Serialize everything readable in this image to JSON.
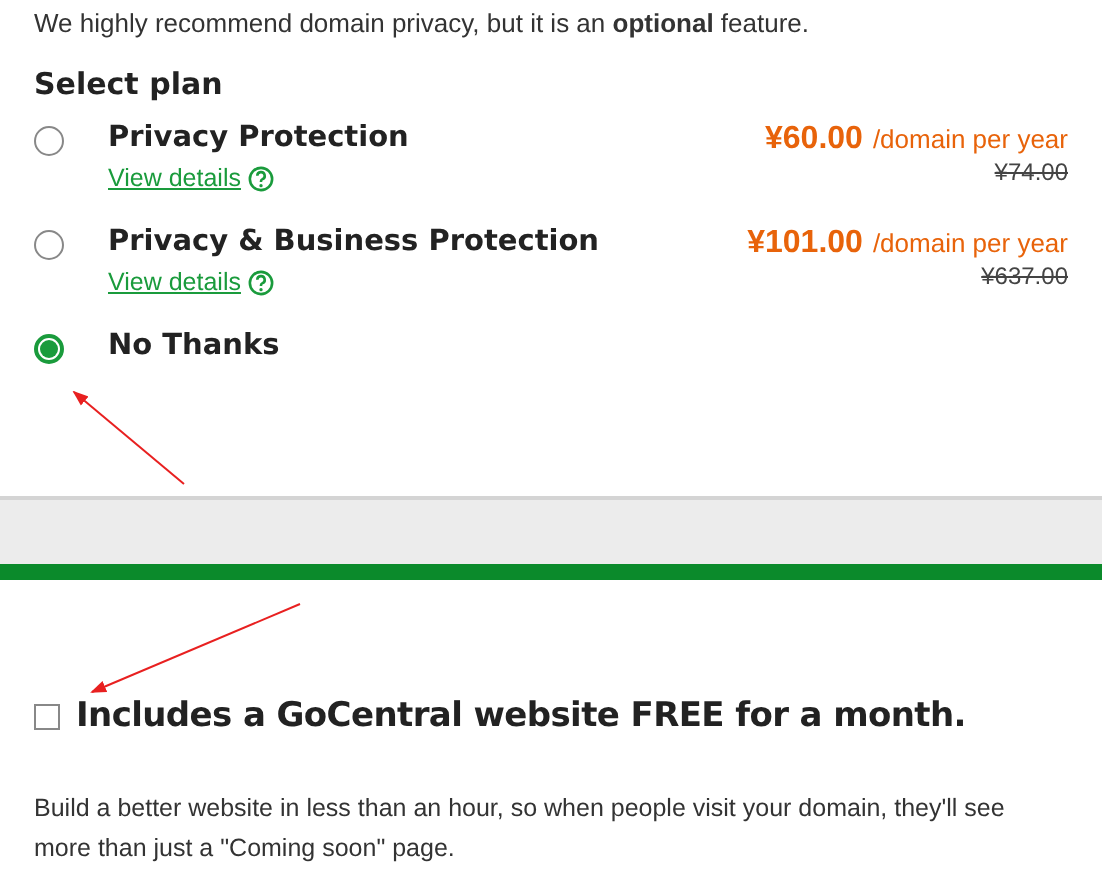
{
  "intro": "We highly recommend domain privacy, but it is an **optional** feature.",
  "plan_heading": "Select plan",
  "plans": [
    {
      "name": "Privacy Protection",
      "selected": false,
      "details": "View details",
      "price": "¥60.00",
      "unit": "/domain per year",
      "old_price": "¥74.00"
    },
    {
      "name": "Privacy & Business Protection",
      "selected": false,
      "details": "View details",
      "price": "¥101.00",
      "unit": "/domain per year",
      "old_price": "¥637.00"
    },
    {
      "name": "No Thanks",
      "selected": true
    }
  ],
  "website_offer": {
    "label": "Includes a GoCentral website FREE for a month.",
    "checked": false,
    "description": "Build a better website in less than an hour, so when people visit your domain, they'll see more than just a \"Coming soon\" page."
  }
}
